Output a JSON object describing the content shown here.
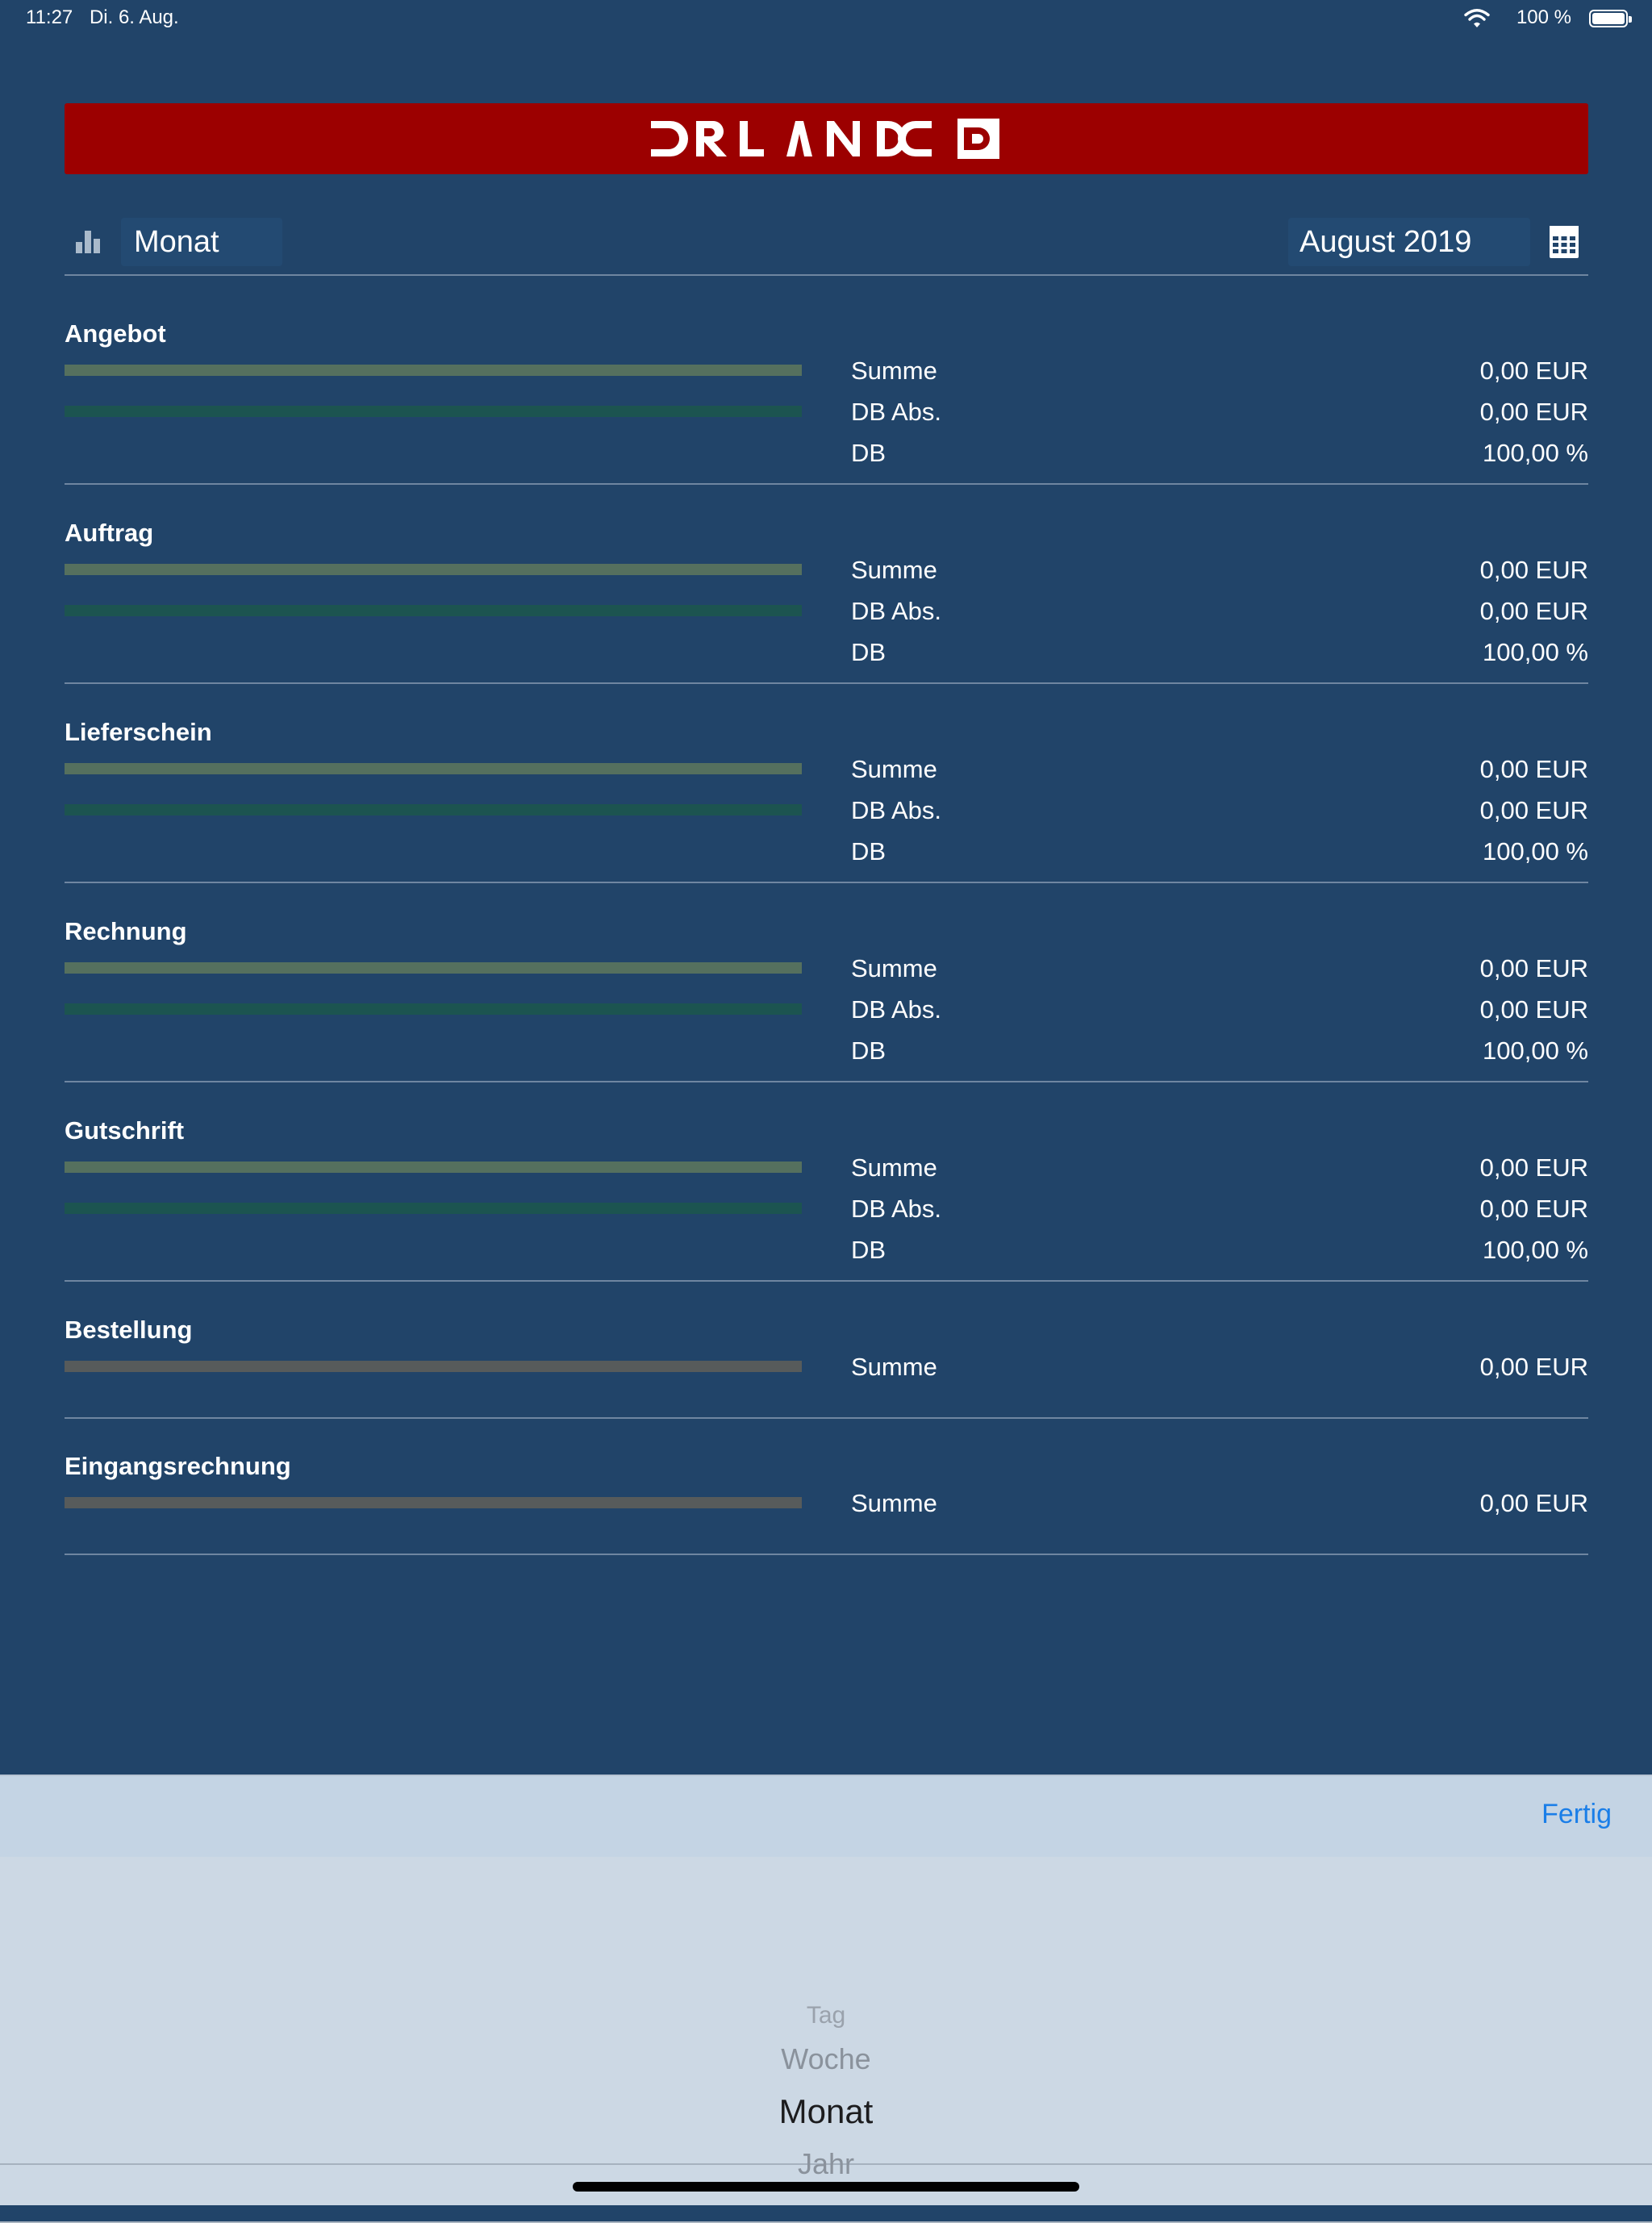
{
  "status_bar": {
    "time": "11:27",
    "date": "Di. 6. Aug.",
    "battery": "100 %"
  },
  "brand": {
    "name": "ORLANDO",
    "banner_color": "#9c0000"
  },
  "filter": {
    "period": "Monat",
    "date": "August 2019"
  },
  "sections": [
    {
      "title": "Angebot",
      "metrics": [
        {
          "label": "Summe",
          "value": "0,00 EUR"
        },
        {
          "label": "DB Abs.",
          "value": "0,00 EUR"
        },
        {
          "label": "DB",
          "value": "100,00 %"
        }
      ]
    },
    {
      "title": "Auftrag",
      "metrics": [
        {
          "label": "Summe",
          "value": "0,00 EUR"
        },
        {
          "label": "DB Abs.",
          "value": "0,00 EUR"
        },
        {
          "label": "DB",
          "value": "100,00 %"
        }
      ]
    },
    {
      "title": "Lieferschein",
      "metrics": [
        {
          "label": "Summe",
          "value": "0,00 EUR"
        },
        {
          "label": "DB Abs.",
          "value": "0,00 EUR"
        },
        {
          "label": "DB",
          "value": "100,00 %"
        }
      ]
    },
    {
      "title": "Rechnung",
      "metrics": [
        {
          "label": "Summe",
          "value": "0,00 EUR"
        },
        {
          "label": "DB Abs.",
          "value": "0,00 EUR"
        },
        {
          "label": "DB",
          "value": "100,00 %"
        }
      ]
    },
    {
      "title": "Gutschrift",
      "metrics": [
        {
          "label": "Summe",
          "value": "0,00 EUR"
        },
        {
          "label": "DB Abs.",
          "value": "0,00 EUR"
        },
        {
          "label": "DB",
          "value": "100,00 %"
        }
      ]
    },
    {
      "title": "Bestellung",
      "metrics": [
        {
          "label": "Summe",
          "value": "0,00 EUR"
        }
      ]
    },
    {
      "title": "Eingangsrechnung",
      "metrics": [
        {
          "label": "Summe",
          "value": "0,00 EUR"
        }
      ]
    }
  ],
  "picker": {
    "done_label": "Fertig",
    "options": [
      "Tag",
      "Woche",
      "Monat",
      "Jahr"
    ],
    "selected": "Monat"
  },
  "colors": {
    "background": "#214469",
    "bar_summe": "#55705e",
    "bar_db_abs": "#1c5450",
    "bar_grey": "#575b5b",
    "accent": "#1a7ee8"
  }
}
